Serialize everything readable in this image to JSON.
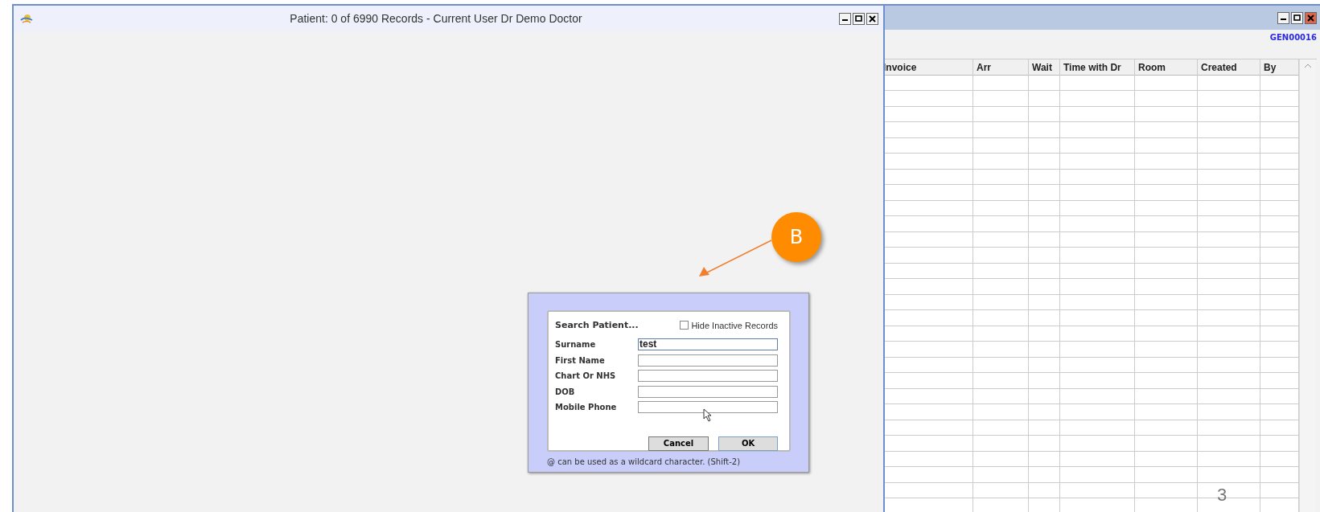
{
  "patient_window": {
    "title": "Patient: 0 of 6990 Records - Current User Dr Demo Doctor"
  },
  "annotation": {
    "label": "B"
  },
  "search_dialog": {
    "title": "Search Patient...",
    "hide_inactive": {
      "label": "Hide Inactive Records",
      "checked": false
    },
    "fields": [
      {
        "label": "Surname",
        "value": "test"
      },
      {
        "label": "First Name"
      },
      {
        "label": "Chart Or NHS"
      },
      {
        "label": "DOB"
      },
      {
        "label": "Mobile Phone"
      }
    ],
    "buttons": [
      "Cancel",
      "OK"
    ],
    "hint": "@ can be used as a wildcard character. (Shift-2)"
  },
  "schedule_window": {
    "code": "GEN00016",
    "columns": [
      "Invoice",
      "Arr",
      "Wait",
      "Time with Dr",
      "Room",
      "Created",
      "By"
    ]
  },
  "page_number": "3"
}
